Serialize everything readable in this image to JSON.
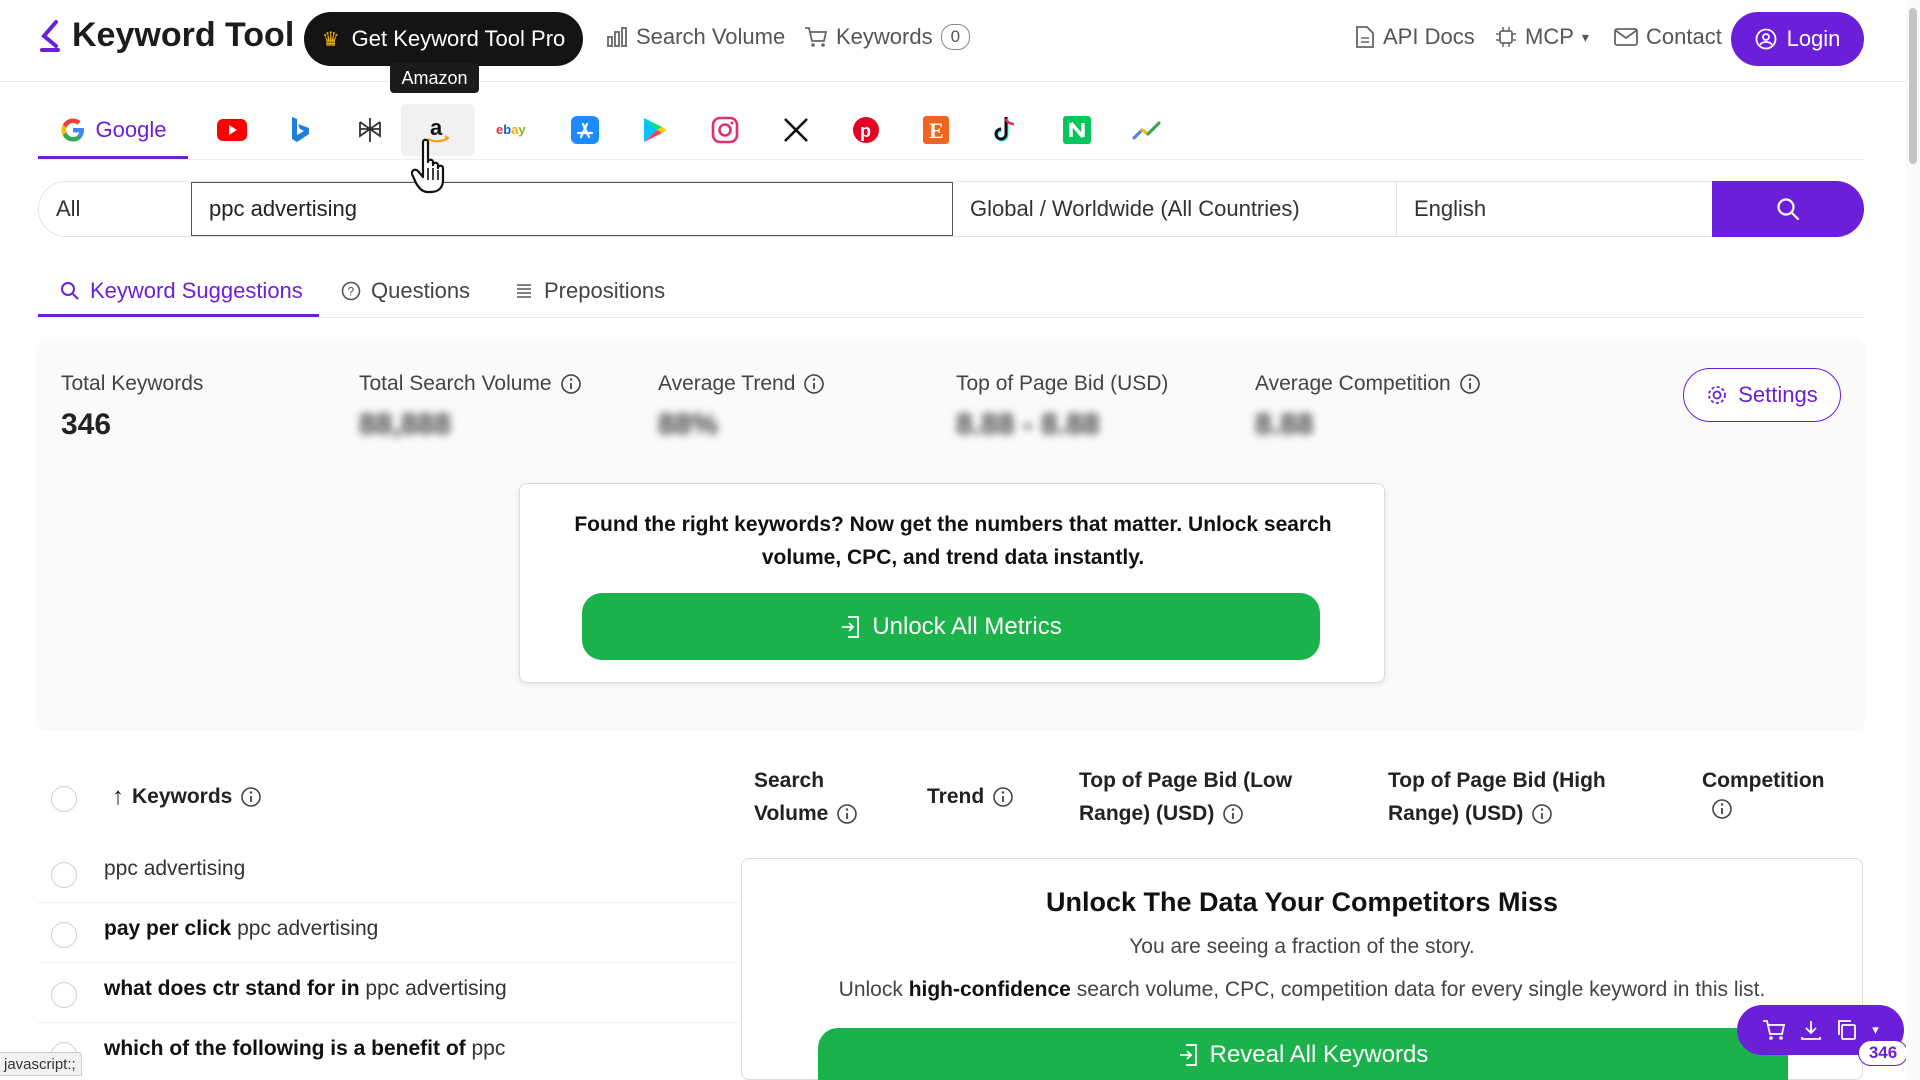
{
  "header": {
    "logo_text": "Keyword Tool",
    "pro_button": "Get Keyword Tool Pro",
    "nav": {
      "search_volume": "Search Volume",
      "keywords": "Keywords",
      "keywords_count": "0",
      "api_docs": "API Docs",
      "mcp": "MCP",
      "contact": "Contact"
    },
    "login": "Login",
    "tooltip": "Amazon"
  },
  "platforms": {
    "active_label": "Google",
    "items": [
      "google-icon",
      "youtube-icon",
      "bing-icon",
      "perplexity-icon",
      "amazon-icon",
      "ebay-icon",
      "app-store-icon",
      "play-store-icon",
      "instagram-icon",
      "x-icon",
      "pinterest-icon",
      "etsy-icon",
      "tiktok-icon",
      "naver-icon",
      "trends-icon"
    ],
    "ebay_text": "ebay"
  },
  "search": {
    "type": "All",
    "query": "ppc advertising",
    "location": "Global / Worldwide (All Countries)",
    "language": "English"
  },
  "result_tabs": [
    "Keyword Suggestions",
    "Questions",
    "Prepositions"
  ],
  "stats": {
    "total_keywords_label": "Total Keywords",
    "total_keywords_value": "346",
    "total_search_volume_label": "Total Search Volume",
    "total_search_volume_value": "88,888",
    "average_trend_label": "Average Trend",
    "average_trend_value": "88%",
    "top_bid_label": "Top of Page Bid (USD)",
    "top_bid_value": "8.88 - 8.88",
    "avg_competition_label": "Average Competition",
    "avg_competition_value": "8.88",
    "settings": "Settings"
  },
  "unlock": {
    "text": "Found the right keywords? Now get the numbers that matter. Unlock search volume, CPC, and trend data instantly.",
    "button": "Unlock All Metrics"
  },
  "table": {
    "headers": {
      "keywords": "Keywords",
      "search_volume_1": "Search",
      "search_volume_2": "Volume",
      "trend": "Trend",
      "bid_low_1": "Top of Page Bid (Low",
      "bid_low_2": "Range) (USD)",
      "bid_high_1": "Top of Page Bid (High",
      "bid_high_2": "Range) (USD)",
      "competition": "Competition"
    },
    "rows": [
      {
        "bold": "",
        "rest": "ppc advertising"
      },
      {
        "bold": "pay per click",
        "rest": "ppc advertising"
      },
      {
        "bold": "what does ctr stand for in",
        "rest": "ppc advertising"
      },
      {
        "bold": "which of the following is a benefit of",
        "rest": "ppc"
      }
    ]
  },
  "cta": {
    "title": "Unlock The Data Your Competitors Miss",
    "subtitle": "You are seeing a fraction of the story.",
    "desc_pre": "Unlock ",
    "desc_bold": "high-confidence",
    "desc_post": " search volume, CPC, competition data for every single keyword in this list.",
    "button": "Reveal All Keywords"
  },
  "floating": {
    "count": "346"
  },
  "statusbar": "javascript:;",
  "colors": {
    "accent": "#6c1fd8",
    "green": "#1cb24b",
    "dark": "#141414"
  }
}
